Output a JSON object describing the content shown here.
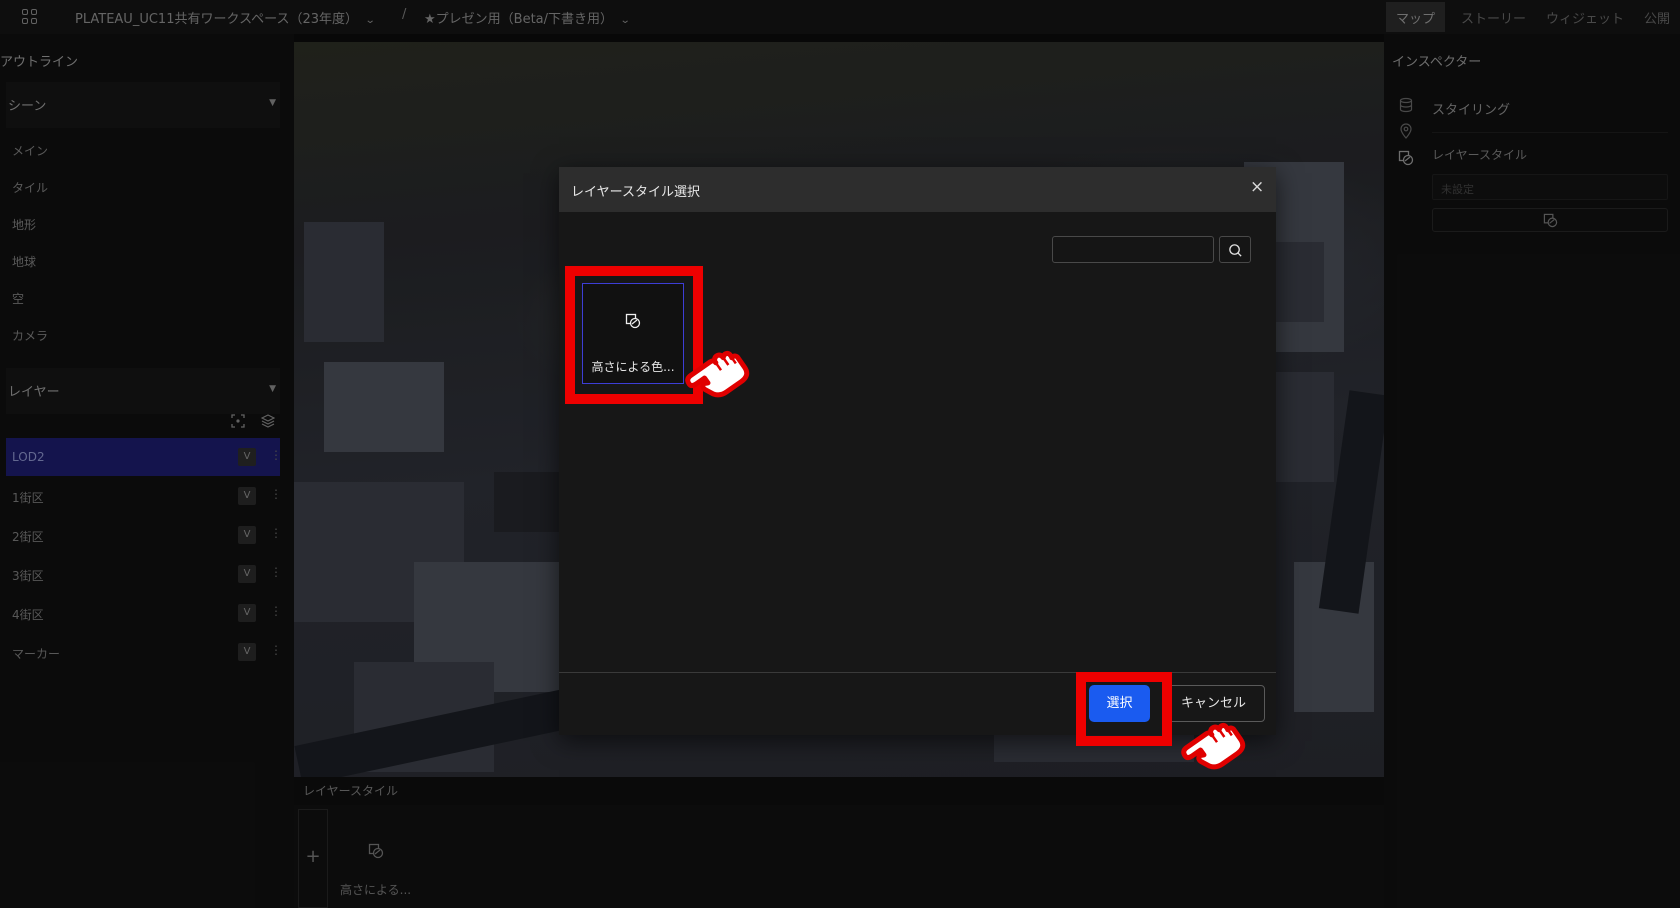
{
  "header": {
    "workspace": "PLATEAU_UC11共有ワークスペース（23年度）",
    "separator": "/",
    "project": "★プレゼン用（Beta/下書き用）",
    "tabs": [
      "マップ",
      "ストーリー",
      "ウィジェット",
      "公開"
    ],
    "active_tab": "マップ"
  },
  "outline": {
    "title": "アウトライン",
    "scene_title": "シーン",
    "scene_items": [
      "メイン",
      "タイル",
      "地形",
      "地球",
      "空",
      "カメラ"
    ],
    "layer_title": "レイヤー",
    "layers": [
      {
        "name": "LOD2",
        "visibility": "V",
        "selected": true
      },
      {
        "name": "1街区",
        "visibility": "V",
        "selected": false
      },
      {
        "name": "2街区",
        "visibility": "V",
        "selected": false
      },
      {
        "name": "3街区",
        "visibility": "V",
        "selected": false
      },
      {
        "name": "4街区",
        "visibility": "V",
        "selected": false
      },
      {
        "name": "マーカー",
        "visibility": "V",
        "selected": false
      }
    ]
  },
  "bottom_panel": {
    "title": "レイヤースタイル",
    "add_label": "+",
    "style_label": "高さによる..."
  },
  "inspector": {
    "title": "インスペクター",
    "section": "スタイリング",
    "field_label": "レイヤースタイル",
    "placeholder": "未設定"
  },
  "modal": {
    "title": "レイヤースタイル選択",
    "close": "×",
    "card_label": "高さによる色...",
    "select_label": "選択",
    "cancel_label": "キャンセル"
  },
  "colors": {
    "accent": "#1a5bf0",
    "selection_border": "#3d3ed6",
    "highlight": "#ee0000",
    "layer_selected": "#1c1d6b"
  }
}
